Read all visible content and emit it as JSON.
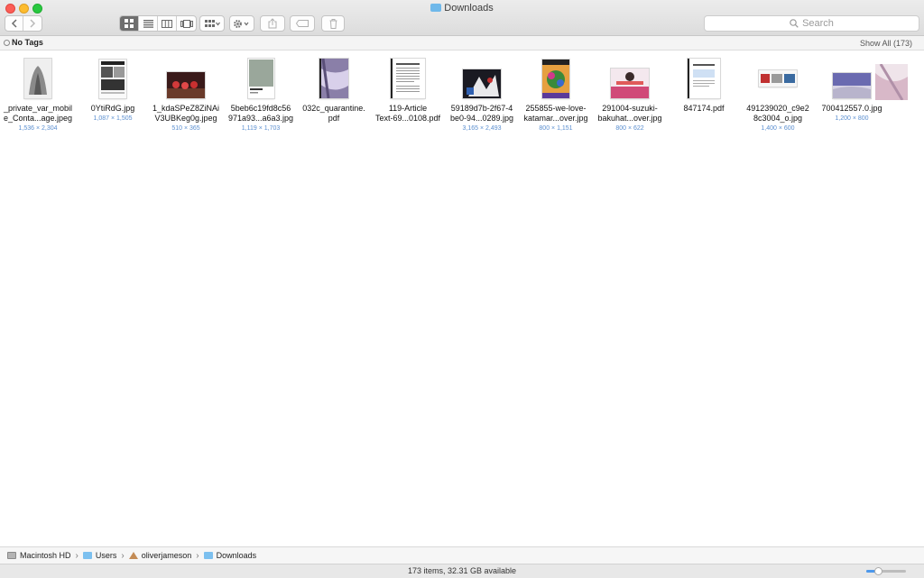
{
  "window": {
    "title": "Downloads"
  },
  "toolbar": {
    "search_placeholder": "Search",
    "view_buttons": [
      "icon-view",
      "list-view",
      "column-view",
      "gallery-view"
    ],
    "active_view": "icon-view"
  },
  "tags_bar": {
    "label": "No Tags",
    "show_all": "Show All (173)"
  },
  "files": [
    {
      "name": "_private_var_mobile_Conta...age.jpeg",
      "line1": "_private_var_mobil",
      "line2": "e_Conta...age.jpeg",
      "dims": "1,536 × 2,304"
    },
    {
      "name": "0YtiRdG.jpg",
      "line1": "0YtiRdG.jpg",
      "line2": "",
      "dims": "1,087 × 1,505"
    },
    {
      "name": "1_kdaSPeZ8ZiNAiV3UBKeg0g.jpeg",
      "line1": "1_kdaSPeZ8ZiNAi",
      "line2": "V3UBKeg0g.jpeg",
      "dims": "510 × 365"
    },
    {
      "name": "5beb6c19fd8c56971a93...a6a3.jpg",
      "line1": "5beb6c19fd8c56",
      "line2": "971a93...a6a3.jpg",
      "dims": "1,119 × 1,703"
    },
    {
      "name": "032c_quarantine.pdf",
      "line1": "032c_quarantine.",
      "line2": "pdf",
      "dims": ""
    },
    {
      "name": "119-Article Text-69...0108.pdf",
      "line1": "119-Article",
      "line2": "Text-69...0108.pdf",
      "dims": ""
    },
    {
      "name": "59189d7b-2f67-4be0-94...0289.jpg",
      "line1": "59189d7b-2f67-4",
      "line2": "be0-94...0289.jpg",
      "dims": "3,165 × 2,493"
    },
    {
      "name": "255855-we-love-katamar...over.jpg",
      "line1": "255855-we-love-",
      "line2": "katamar...over.jpg",
      "dims": "800 × 1,151"
    },
    {
      "name": "291004-suzuki-bakuhat...over.jpg",
      "line1": "291004-suzuki-",
      "line2": "bakuhat...over.jpg",
      "dims": "800 × 622"
    },
    {
      "name": "847174.pdf",
      "line1": "847174.pdf",
      "line2": "",
      "dims": ""
    },
    {
      "name": "491239020_c9e28c3004_o.jpg",
      "line1": "491239020_c9e2",
      "line2": "8c3004_o.jpg",
      "dims": "1,400 × 600"
    },
    {
      "name": "700412557.0.jpg",
      "line1": "700412557.0.jpg",
      "line2": "",
      "dims": "1,200 × 800"
    }
  ],
  "path_bar": {
    "crumbs": [
      "Macintosh HD",
      "Users",
      "oliverjameson",
      "Downloads"
    ]
  },
  "status_bar": {
    "text": "173 items, 32.31 GB available",
    "icon_size_level": 0.3
  },
  "colors": {
    "accent": "#4d98ec",
    "folder": "#7cc0ef",
    "dims_text": "#5b8fd0"
  }
}
